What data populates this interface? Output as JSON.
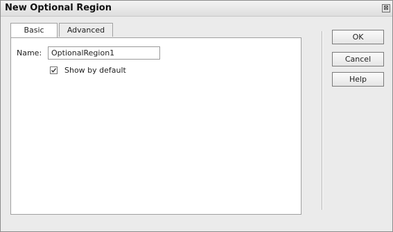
{
  "window": {
    "title": "New Optional Region",
    "close_glyph": "⊠"
  },
  "tabs": [
    {
      "label": "Basic",
      "active": true
    },
    {
      "label": "Advanced",
      "active": false
    }
  ],
  "form": {
    "name_label": "Name:",
    "name_value": "OptionalRegion1",
    "show_by_default_label": "Show by default",
    "show_by_default_checked": true
  },
  "buttons": {
    "ok": "OK",
    "cancel": "Cancel",
    "help": "Help"
  }
}
